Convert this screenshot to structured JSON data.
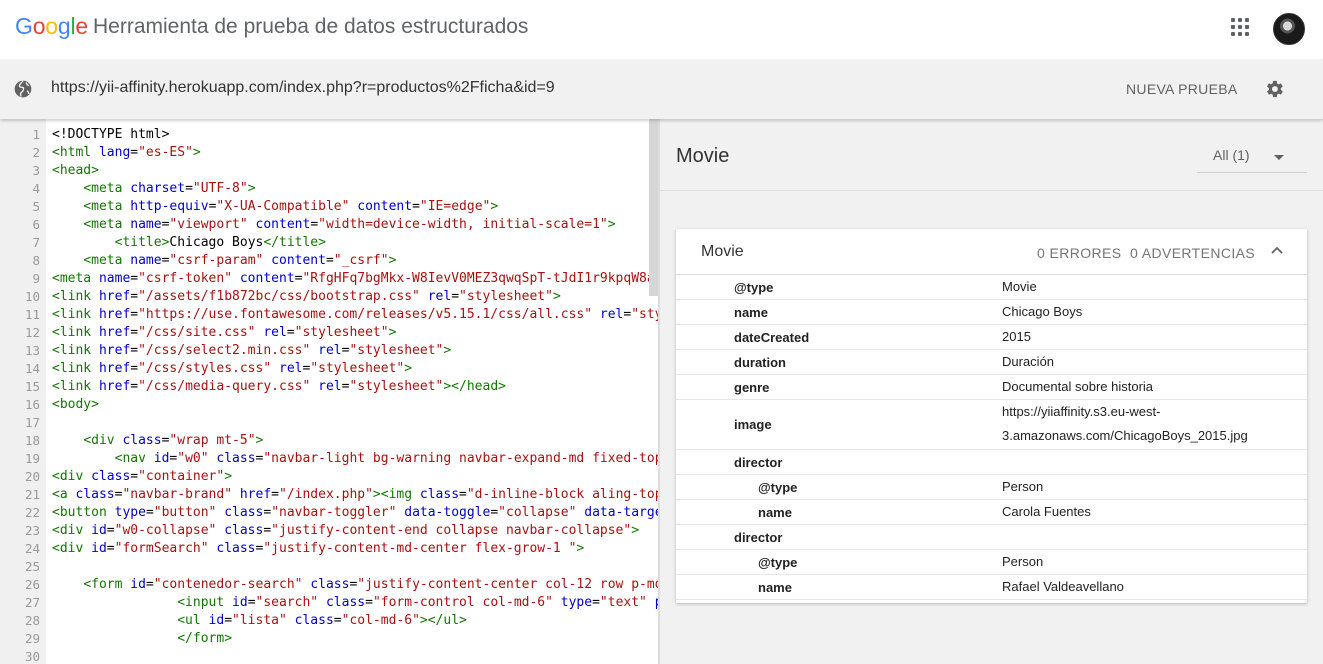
{
  "header": {
    "logo": [
      "G",
      "o",
      "o",
      "g",
      "l",
      "e"
    ],
    "logo_colors": [
      "#4285F4",
      "#EA4335",
      "#FBBC05",
      "#4285F4",
      "#34A853",
      "#EA4335"
    ],
    "title": "Herramienta de prueba de datos estructurados",
    "apps_icon": "apps-grid-icon",
    "avatar_icon": "user-avatar"
  },
  "urlbar": {
    "url": "https://yii-affinity.herokuapp.com/index.php?r=productos%2Fficha&id=9",
    "new_test_label": "NUEVA PRUEBA",
    "settings_icon": "gear-icon",
    "globe_icon": "globe-icon"
  },
  "code_lines": [
    {
      "n": "1",
      "parts": [
        [
          "tx",
          "<!DOCTYPE html>"
        ]
      ]
    },
    {
      "n": "2",
      "parts": [
        [
          "tg",
          "<html "
        ],
        [
          "at",
          "lang"
        ],
        [
          "tx",
          "="
        ],
        [
          "st",
          "\"es-ES\""
        ],
        [
          "tg",
          ">"
        ]
      ]
    },
    {
      "n": "3",
      "parts": [
        [
          "tg",
          "<head>"
        ]
      ]
    },
    {
      "n": "4",
      "parts": [
        [
          "tx",
          "    "
        ],
        [
          "tg",
          "<meta "
        ],
        [
          "at",
          "charset"
        ],
        [
          "tx",
          "="
        ],
        [
          "st",
          "\"UTF-8\""
        ],
        [
          "tg",
          ">"
        ]
      ]
    },
    {
      "n": "5",
      "parts": [
        [
          "tx",
          "    "
        ],
        [
          "tg",
          "<meta "
        ],
        [
          "at",
          "http-equiv"
        ],
        [
          "tx",
          "="
        ],
        [
          "st",
          "\"X-UA-Compatible\" "
        ],
        [
          "at",
          "content"
        ],
        [
          "tx",
          "="
        ],
        [
          "st",
          "\"IE=edge\""
        ],
        [
          "tg",
          ">"
        ]
      ]
    },
    {
      "n": "6",
      "parts": [
        [
          "tx",
          "    "
        ],
        [
          "tg",
          "<meta "
        ],
        [
          "at",
          "name"
        ],
        [
          "tx",
          "="
        ],
        [
          "st",
          "\"viewport\" "
        ],
        [
          "at",
          "content"
        ],
        [
          "tx",
          "="
        ],
        [
          "st",
          "\"width=device-width, initial-scale=1\""
        ],
        [
          "tg",
          ">"
        ]
      ]
    },
    {
      "n": "7",
      "parts": [
        [
          "tx",
          "        "
        ],
        [
          "tg",
          "<title>"
        ],
        [
          "tx",
          "Chicago Boys"
        ],
        [
          "tg",
          "</title>"
        ]
      ]
    },
    {
      "n": "8",
      "parts": [
        [
          "tx",
          "    "
        ],
        [
          "tg",
          "<meta "
        ],
        [
          "at",
          "name"
        ],
        [
          "tx",
          "="
        ],
        [
          "st",
          "\"csrf-param\" "
        ],
        [
          "at",
          "content"
        ],
        [
          "tx",
          "="
        ],
        [
          "st",
          "\"_csrf\""
        ],
        [
          "tg",
          ">"
        ]
      ]
    },
    {
      "n": "9",
      "parts": [
        [
          "tg",
          "<meta "
        ],
        [
          "at",
          "name"
        ],
        [
          "tx",
          "="
        ],
        [
          "st",
          "\"csrf-token\" "
        ],
        [
          "at",
          "content"
        ],
        [
          "tx",
          "="
        ],
        [
          "st",
          "\"RfgHFq7bgMkx-W8IevV0MEZ3qwqSpT-tJdI1r9kpqW8a7"
        ]
      ]
    },
    {
      "n": "10",
      "parts": [
        [
          "tg",
          "<link "
        ],
        [
          "at",
          "href"
        ],
        [
          "tx",
          "="
        ],
        [
          "st",
          "\"/assets/f1b872bc/css/bootstrap.css\" "
        ],
        [
          "at",
          "rel"
        ],
        [
          "tx",
          "="
        ],
        [
          "st",
          "\"stylesheet\""
        ],
        [
          "tg",
          ">"
        ]
      ]
    },
    {
      "n": "11",
      "parts": [
        [
          "tg",
          "<link "
        ],
        [
          "at",
          "href"
        ],
        [
          "tx",
          "="
        ],
        [
          "st",
          "\"https://use.fontawesome.com/releases/v5.15.1/css/all.css\" "
        ],
        [
          "at",
          "rel"
        ],
        [
          "tx",
          "="
        ],
        [
          "st",
          "\"sty"
        ]
      ]
    },
    {
      "n": "12",
      "parts": [
        [
          "tg",
          "<link "
        ],
        [
          "at",
          "href"
        ],
        [
          "tx",
          "="
        ],
        [
          "st",
          "\"/css/site.css\" "
        ],
        [
          "at",
          "rel"
        ],
        [
          "tx",
          "="
        ],
        [
          "st",
          "\"stylesheet\""
        ],
        [
          "tg",
          ">"
        ]
      ]
    },
    {
      "n": "13",
      "parts": [
        [
          "tg",
          "<link "
        ],
        [
          "at",
          "href"
        ],
        [
          "tx",
          "="
        ],
        [
          "st",
          "\"/css/select2.min.css\" "
        ],
        [
          "at",
          "rel"
        ],
        [
          "tx",
          "="
        ],
        [
          "st",
          "\"stylesheet\""
        ],
        [
          "tg",
          ">"
        ]
      ]
    },
    {
      "n": "14",
      "parts": [
        [
          "tg",
          "<link "
        ],
        [
          "at",
          "href"
        ],
        [
          "tx",
          "="
        ],
        [
          "st",
          "\"/css/styles.css\" "
        ],
        [
          "at",
          "rel"
        ],
        [
          "tx",
          "="
        ],
        [
          "st",
          "\"stylesheet\""
        ],
        [
          "tg",
          ">"
        ]
      ]
    },
    {
      "n": "15",
      "parts": [
        [
          "tg",
          "<link "
        ],
        [
          "at",
          "href"
        ],
        [
          "tx",
          "="
        ],
        [
          "st",
          "\"/css/media-query.css\" "
        ],
        [
          "at",
          "rel"
        ],
        [
          "tx",
          "="
        ],
        [
          "st",
          "\"stylesheet\""
        ],
        [
          "tg",
          "></head>"
        ]
      ]
    },
    {
      "n": "16",
      "parts": [
        [
          "tg",
          "<body>"
        ]
      ]
    },
    {
      "n": "17",
      "parts": []
    },
    {
      "n": "18",
      "parts": [
        [
          "tx",
          "    "
        ],
        [
          "tg",
          "<div "
        ],
        [
          "at",
          "class"
        ],
        [
          "tx",
          "="
        ],
        [
          "st",
          "\"wrap mt-5\""
        ],
        [
          "tg",
          ">"
        ]
      ]
    },
    {
      "n": "19",
      "parts": [
        [
          "tx",
          "        "
        ],
        [
          "tg",
          "<nav "
        ],
        [
          "at",
          "id"
        ],
        [
          "tx",
          "="
        ],
        [
          "st",
          "\"w0\" "
        ],
        [
          "at",
          "class"
        ],
        [
          "tx",
          "="
        ],
        [
          "st",
          "\"navbar-light bg-warning navbar-expand-md fixed-top"
        ]
      ]
    },
    {
      "n": "20",
      "parts": [
        [
          "tg",
          "<div "
        ],
        [
          "at",
          "class"
        ],
        [
          "tx",
          "="
        ],
        [
          "st",
          "\"container\""
        ],
        [
          "tg",
          ">"
        ]
      ]
    },
    {
      "n": "21",
      "parts": [
        [
          "tg",
          "<a "
        ],
        [
          "at",
          "class"
        ],
        [
          "tx",
          "="
        ],
        [
          "st",
          "\"navbar-brand\" "
        ],
        [
          "at",
          "href"
        ],
        [
          "tx",
          "="
        ],
        [
          "st",
          "\"/index.php\""
        ],
        [
          "tg",
          "><img "
        ],
        [
          "at",
          "class"
        ],
        [
          "tx",
          "="
        ],
        [
          "st",
          "\"d-inline-block aling-top"
        ]
      ]
    },
    {
      "n": "22",
      "parts": [
        [
          "tg",
          "<button "
        ],
        [
          "at",
          "type"
        ],
        [
          "tx",
          "="
        ],
        [
          "st",
          "\"button\" "
        ],
        [
          "at",
          "class"
        ],
        [
          "tx",
          "="
        ],
        [
          "st",
          "\"navbar-toggler\" "
        ],
        [
          "at",
          "data-toggle"
        ],
        [
          "tx",
          "="
        ],
        [
          "st",
          "\"collapse\" "
        ],
        [
          "at",
          "data-target"
        ]
      ]
    },
    {
      "n": "23",
      "parts": [
        [
          "tg",
          "<div "
        ],
        [
          "at",
          "id"
        ],
        [
          "tx",
          "="
        ],
        [
          "st",
          "\"w0-collapse\" "
        ],
        [
          "at",
          "class"
        ],
        [
          "tx",
          "="
        ],
        [
          "st",
          "\"justify-content-end collapse navbar-collapse\""
        ],
        [
          "tg",
          ">"
        ]
      ]
    },
    {
      "n": "24",
      "parts": [
        [
          "tg",
          "<div "
        ],
        [
          "at",
          "id"
        ],
        [
          "tx",
          "="
        ],
        [
          "st",
          "\"formSearch\" "
        ],
        [
          "at",
          "class"
        ],
        [
          "tx",
          "="
        ],
        [
          "st",
          "\"justify-content-md-center flex-grow-1 \""
        ],
        [
          "tg",
          ">"
        ]
      ]
    },
    {
      "n": "25",
      "parts": []
    },
    {
      "n": "26",
      "parts": [
        [
          "tx",
          "    "
        ],
        [
          "tg",
          "<form "
        ],
        [
          "at",
          "id"
        ],
        [
          "tx",
          "="
        ],
        [
          "st",
          "\"contenedor-search\" "
        ],
        [
          "at",
          "class"
        ],
        [
          "tx",
          "="
        ],
        [
          "st",
          "\"justify-content-center col-12 row p-md-"
        ]
      ]
    },
    {
      "n": "27",
      "parts": [
        [
          "tx",
          "                "
        ],
        [
          "tg",
          "<input "
        ],
        [
          "at",
          "id"
        ],
        [
          "tx",
          "="
        ],
        [
          "st",
          "\"search\" "
        ],
        [
          "at",
          "class"
        ],
        [
          "tx",
          "="
        ],
        [
          "st",
          "\"form-control col-md-6\" "
        ],
        [
          "at",
          "type"
        ],
        [
          "tx",
          "="
        ],
        [
          "st",
          "\"text\" "
        ],
        [
          "at",
          "p"
        ]
      ]
    },
    {
      "n": "28",
      "parts": [
        [
          "tx",
          "                "
        ],
        [
          "tg",
          "<ul "
        ],
        [
          "at",
          "id"
        ],
        [
          "tx",
          "="
        ],
        [
          "st",
          "\"lista\" "
        ],
        [
          "at",
          "class"
        ],
        [
          "tx",
          "="
        ],
        [
          "st",
          "\"col-md-6\""
        ],
        [
          "tg",
          "></ul>"
        ]
      ]
    },
    {
      "n": "29",
      "parts": [
        [
          "tx",
          "                "
        ],
        [
          "tg",
          "</form>"
        ]
      ]
    },
    {
      "n": "30",
      "parts": []
    }
  ],
  "results": {
    "title": "Movie",
    "filter_label": "All (1)",
    "card": {
      "title": "Movie",
      "errors": "0 ERRORES",
      "warnings": "0 ADVERTENCIAS",
      "rows": [
        {
          "key": "@type",
          "value": [
            "Movie"
          ],
          "indent": 0
        },
        {
          "key": "name",
          "value": [
            "Chicago Boys"
          ],
          "indent": 0
        },
        {
          "key": "dateCreated",
          "value": [
            "2015"
          ],
          "indent": 0
        },
        {
          "key": "duration",
          "value": [
            "Duración"
          ],
          "indent": 0
        },
        {
          "key": "genre",
          "value": [
            "Documental sobre historia"
          ],
          "indent": 0
        },
        {
          "key": "image",
          "value": [
            "https://yiiaffinity.s3.eu-west-",
            "3.amazonaws.com/ChicagoBoys_2015.jpg"
          ],
          "indent": 0
        },
        {
          "key": "director",
          "value": [],
          "indent": 0
        },
        {
          "key": "@type",
          "value": [
            "Person"
          ],
          "indent": 1
        },
        {
          "key": "name",
          "value": [
            "Carola Fuentes"
          ],
          "indent": 1
        },
        {
          "key": "director",
          "value": [],
          "indent": 0
        },
        {
          "key": "@type",
          "value": [
            "Person"
          ],
          "indent": 1
        },
        {
          "key": "name",
          "value": [
            "Rafael Valdeavellano"
          ],
          "indent": 1
        }
      ]
    }
  }
}
